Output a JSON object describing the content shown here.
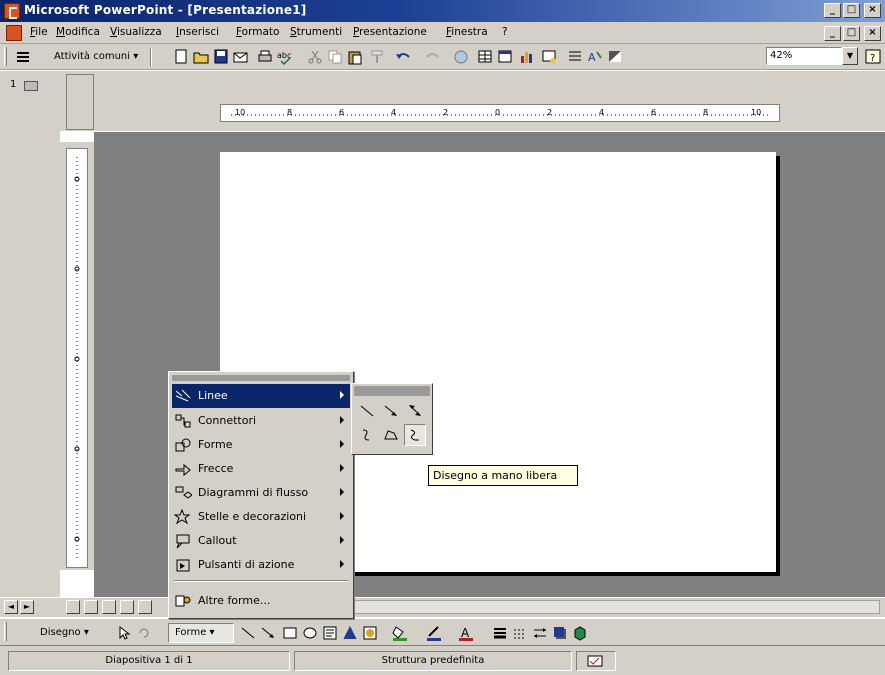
{
  "window": {
    "title": "Microsoft PowerPoint - [Presentazione1]",
    "minimize_glyph": "_",
    "restore_glyph": "□",
    "close_glyph": "×"
  },
  "menubar": {
    "items": [
      "File",
      "Modifica",
      "Visualizza",
      "Inserisci",
      "Formato",
      "Strumenti",
      "Presentazione",
      "Finestra",
      "?"
    ]
  },
  "toolbar": {
    "attivita_label": "Attività comuni ▾",
    "zoom_value": "42%",
    "zoom_arrow": "▼"
  },
  "left_pane": {
    "slide_number": "1"
  },
  "hruler": {
    "ticks": [
      "10",
      "8",
      "6",
      "4",
      "2",
      "0",
      "2",
      "4",
      "6",
      "8",
      "10"
    ]
  },
  "viewbar": {
    "scroll_left": "◄",
    "scroll_right": "►"
  },
  "drawbar": {
    "disegno_label": "Disegno ▾",
    "forme_label": "Forme ▾"
  },
  "forme_menu": {
    "items": [
      {
        "label": "Linee",
        "icon": "lines-icon",
        "has_submenu": true
      },
      {
        "label": "Connettori",
        "icon": "connectors-icon",
        "has_submenu": true
      },
      {
        "label": "Forme",
        "icon": "shapes-icon",
        "has_submenu": true
      },
      {
        "label": "Frecce",
        "icon": "arrows-icon",
        "has_submenu": true
      },
      {
        "label": "Diagrammi di flusso",
        "icon": "flowchart-icon",
        "has_submenu": true
      },
      {
        "label": "Stelle e decorazioni",
        "icon": "stars-icon",
        "has_submenu": true
      },
      {
        "label": "Callout",
        "icon": "callout-icon",
        "has_submenu": true
      },
      {
        "label": "Pulsanti di azione",
        "icon": "action-buttons-icon",
        "has_submenu": true
      }
    ],
    "more_label": "Altre forme..."
  },
  "linee_submenu": {
    "tools": [
      "line",
      "arrow",
      "double-arrow",
      "curve",
      "freeform",
      "scribble"
    ]
  },
  "tooltip": {
    "text": "Disegno a mano libera"
  },
  "statusbar": {
    "slide_info": "Diapositiva 1 di 1",
    "design": "Struttura predefinita"
  },
  "colors": {
    "title_bar": "#0a246a",
    "face": "#d4d0c8",
    "workspace": "#808080",
    "selection": "#0a246a",
    "tooltip_bg": "#ffffe1"
  }
}
